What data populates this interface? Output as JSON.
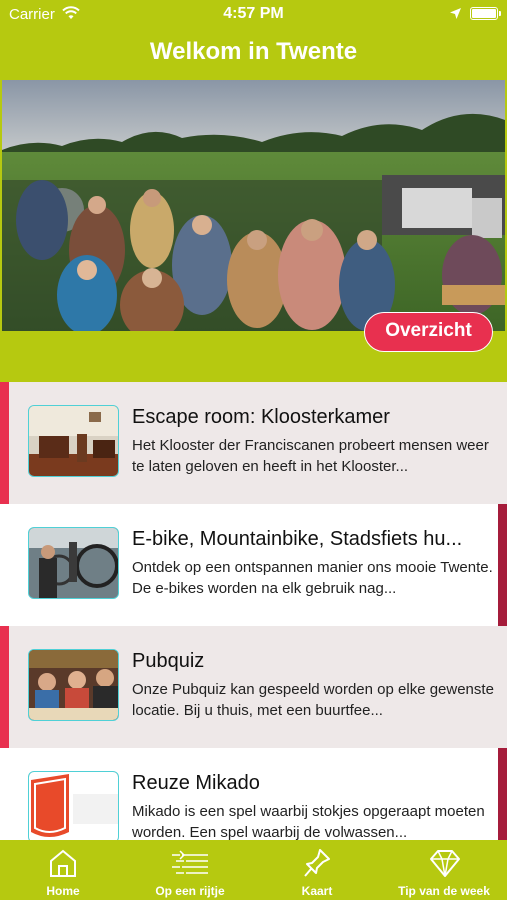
{
  "status_bar": {
    "carrier": "Carrier",
    "time": "4:57 PM"
  },
  "nav": {
    "title": "Welkom in Twente"
  },
  "hero": {
    "overview_button": "Overzicht"
  },
  "activities": [
    {
      "title": "Escape room: Kloosterkamer",
      "description": "Het Klooster der Franciscanen probeert mensen weer te laten geloven en heeft in het Klooster..."
    },
    {
      "title": "E-bike, Mountainbike, Stadsfiets hu...",
      "description": "Ontdek op een ontspannen manier ons mooie Twente. De e-bikes worden na elk gebruik nag..."
    },
    {
      "title": "Pubquiz",
      "description": "Onze Pubquiz kan gespeeld worden op elke gewenste locatie. Bij u thuis, met een buurtfee..."
    },
    {
      "title": "Reuze Mikado",
      "description": "Mikado is een spel waarbij stokjes opgeraapt moeten worden. Een spel waarbij de volwassen..."
    }
  ],
  "tabs": [
    {
      "label": "Home",
      "icon": "home-icon"
    },
    {
      "label": "Op een rijtje",
      "icon": "list-icon"
    },
    {
      "label": "Kaart",
      "icon": "pin-icon"
    },
    {
      "label": "Tip van de week",
      "icon": "diamond-icon"
    }
  ],
  "colors": {
    "brand_green": "#b6c910",
    "accent_red": "#e8304f",
    "dark_red": "#a51c3b",
    "thumb_border": "#4fd0d6"
  }
}
